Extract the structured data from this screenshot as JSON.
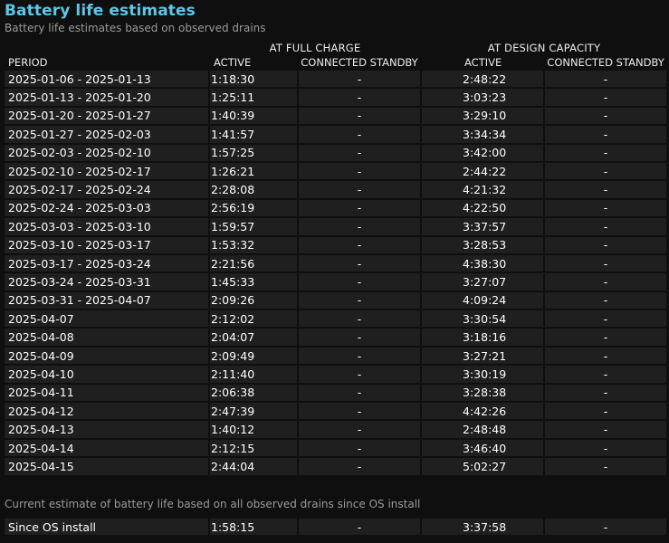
{
  "title": "Battery life estimates",
  "subtitle": "Battery life estimates based on observed drains",
  "headers": {
    "full_charge": "AT FULL CHARGE",
    "design_capacity": "AT DESIGN CAPACITY",
    "period": "PERIOD",
    "active": "ACTIVE",
    "connected_standby": "CONNECTED STANDBY"
  },
  "rows": [
    {
      "period": "2025-01-06 - 2025-01-13",
      "fc_active": "1:18:30",
      "fc_standby": "-",
      "dc_active": "2:48:22",
      "dc_standby": "-"
    },
    {
      "period": "2025-01-13 - 2025-01-20",
      "fc_active": "1:25:11",
      "fc_standby": "-",
      "dc_active": "3:03:23",
      "dc_standby": "-"
    },
    {
      "period": "2025-01-20 - 2025-01-27",
      "fc_active": "1:40:39",
      "fc_standby": "-",
      "dc_active": "3:29:10",
      "dc_standby": "-"
    },
    {
      "period": "2025-01-27 - 2025-02-03",
      "fc_active": "1:41:57",
      "fc_standby": "-",
      "dc_active": "3:34:34",
      "dc_standby": "-"
    },
    {
      "period": "2025-02-03 - 2025-02-10",
      "fc_active": "1:57:25",
      "fc_standby": "-",
      "dc_active": "3:42:00",
      "dc_standby": "-"
    },
    {
      "period": "2025-02-10 - 2025-02-17",
      "fc_active": "1:26:21",
      "fc_standby": "-",
      "dc_active": "2:44:22",
      "dc_standby": "-"
    },
    {
      "period": "2025-02-17 - 2025-02-24",
      "fc_active": "2:28:08",
      "fc_standby": "-",
      "dc_active": "4:21:32",
      "dc_standby": "-"
    },
    {
      "period": "2025-02-24 - 2025-03-03",
      "fc_active": "2:56:19",
      "fc_standby": "-",
      "dc_active": "4:22:50",
      "dc_standby": "-"
    },
    {
      "period": "2025-03-03 - 2025-03-10",
      "fc_active": "1:59:57",
      "fc_standby": "-",
      "dc_active": "3:37:57",
      "dc_standby": "-"
    },
    {
      "period": "2025-03-10 - 2025-03-17",
      "fc_active": "1:53:32",
      "fc_standby": "-",
      "dc_active": "3:28:53",
      "dc_standby": "-"
    },
    {
      "period": "2025-03-17 - 2025-03-24",
      "fc_active": "2:21:56",
      "fc_standby": "-",
      "dc_active": "4:38:30",
      "dc_standby": "-"
    },
    {
      "period": "2025-03-24 - 2025-03-31",
      "fc_active": "1:45:33",
      "fc_standby": "-",
      "dc_active": "3:27:07",
      "dc_standby": "-"
    },
    {
      "period": "2025-03-31 - 2025-04-07",
      "fc_active": "2:09:26",
      "fc_standby": "-",
      "dc_active": "4:09:24",
      "dc_standby": "-"
    },
    {
      "period": "2025-04-07",
      "fc_active": "2:12:02",
      "fc_standby": "-",
      "dc_active": "3:30:54",
      "dc_standby": "-"
    },
    {
      "period": "2025-04-08",
      "fc_active": "2:04:07",
      "fc_standby": "-",
      "dc_active": "3:18:16",
      "dc_standby": "-"
    },
    {
      "period": "2025-04-09",
      "fc_active": "2:09:49",
      "fc_standby": "-",
      "dc_active": "3:27:21",
      "dc_standby": "-"
    },
    {
      "period": "2025-04-10",
      "fc_active": "2:11:40",
      "fc_standby": "-",
      "dc_active": "3:30:19",
      "dc_standby": "-"
    },
    {
      "period": "2025-04-11",
      "fc_active": "2:06:38",
      "fc_standby": "-",
      "dc_active": "3:28:38",
      "dc_standby": "-"
    },
    {
      "period": "2025-04-12",
      "fc_active": "2:47:39",
      "fc_standby": "-",
      "dc_active": "4:42:26",
      "dc_standby": "-"
    },
    {
      "period": "2025-04-13",
      "fc_active": "1:40:12",
      "fc_standby": "-",
      "dc_active": "2:48:48",
      "dc_standby": "-"
    },
    {
      "period": "2025-04-14",
      "fc_active": "2:12:15",
      "fc_standby": "-",
      "dc_active": "3:46:40",
      "dc_standby": "-"
    },
    {
      "period": "2025-04-15",
      "fc_active": "2:44:04",
      "fc_standby": "-",
      "dc_active": "5:02:27",
      "dc_standby": "-"
    }
  ],
  "current_estimate": {
    "caption": "Current estimate of battery life based on all observed drains since OS install",
    "row": {
      "period": "Since OS install",
      "fc_active": "1:58:15",
      "fc_standby": "-",
      "dc_active": "3:37:58",
      "dc_standby": "-"
    }
  }
}
